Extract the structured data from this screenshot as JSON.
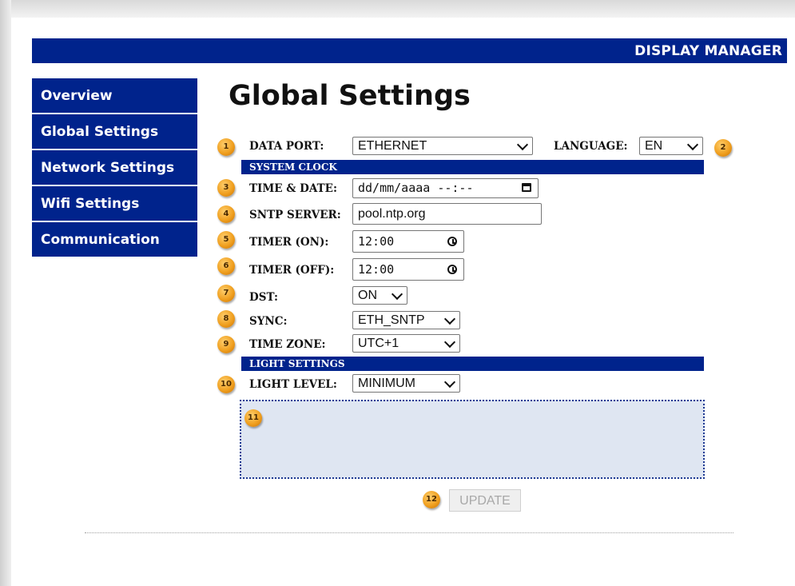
{
  "header": {
    "title": "DISPLAY MANAGER"
  },
  "sidebar": {
    "items": [
      {
        "label": "Overview"
      },
      {
        "label": "Global Settings"
      },
      {
        "label": "Network Settings"
      },
      {
        "label": "Wifi Settings"
      },
      {
        "label": "Communication"
      }
    ]
  },
  "page_title": "Global Settings",
  "badges": [
    "1",
    "2",
    "3",
    "4",
    "5",
    "6",
    "7",
    "8",
    "9",
    "10",
    "11",
    "12"
  ],
  "form": {
    "data_port": {
      "label": "DATA PORT:",
      "value": "ETHERNET"
    },
    "language": {
      "label": "LANGUAGE:",
      "value": "EN"
    },
    "system_clock_header": "SYSTEM CLOCK",
    "time_date": {
      "label": "TIME & DATE:",
      "value": "dd/mm/aaaa --:--"
    },
    "sntp_server": {
      "label": "SNTP SERVER:",
      "value": "pool.ntp.org"
    },
    "timer_on": {
      "label": "TIMER (ON):",
      "value": "12:00"
    },
    "timer_off": {
      "label": "TIMER (OFF):",
      "value": "12:00"
    },
    "dst": {
      "label": "DST:",
      "value": "ON"
    },
    "sync": {
      "label": "SYNC:",
      "value": "ETH_SNTP"
    },
    "time_zone": {
      "label": "TIME ZONE:",
      "value": "UTC+1"
    },
    "light_settings_header": "LIGHT SETTINGS",
    "light_level": {
      "label": "LIGHT LEVEL:",
      "value": "MINIMUM"
    }
  },
  "update_button": {
    "label": "UPDATE"
  },
  "colors": {
    "brand_blue": "#00238c",
    "badge_orange": "#f0a020"
  },
  "icons": [
    "chevron-down-icon",
    "calendar-icon",
    "clock-icon"
  ]
}
